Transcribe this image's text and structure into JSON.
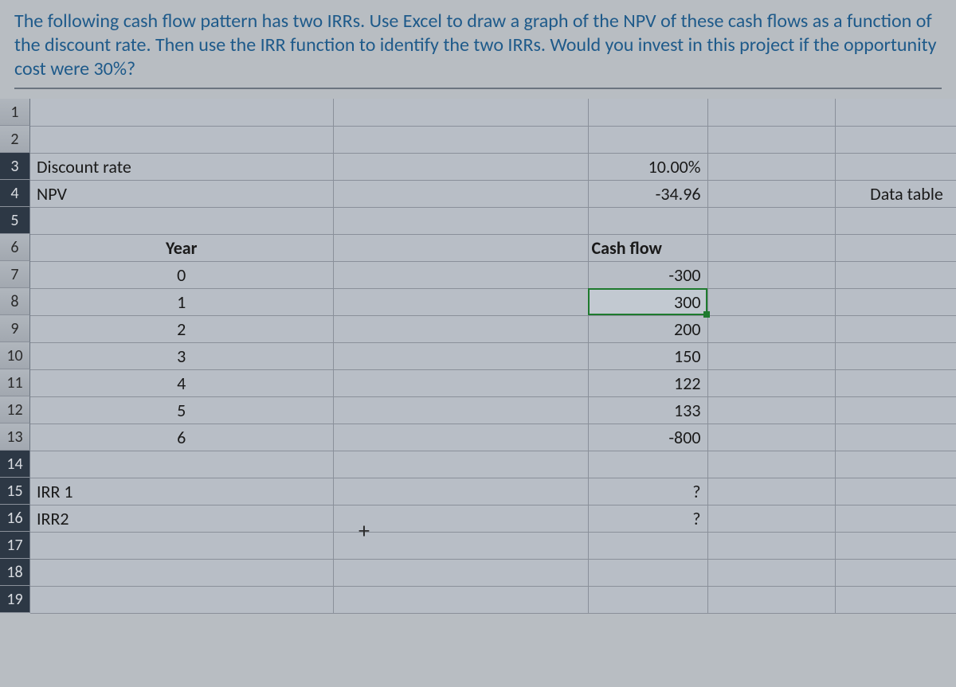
{
  "question": "The following cash flow pattern has two IRRs. Use Excel to draw a graph of the NPV of these cash flows as a function of the discount rate. Then use the IRR function to identify the two IRRs. Would you invest in this project if the opportunity cost were 30%?",
  "rows": {
    "r3": {
      "label": "Discount rate",
      "value": "10.00%"
    },
    "r4": {
      "label": "NPV",
      "value": "-34.96",
      "extra": "Data table"
    },
    "r6": {
      "yearHeader": "Year",
      "cfHeader": "Cash flow"
    },
    "r7": {
      "year": "0",
      "cf": "-300"
    },
    "r8": {
      "year": "1",
      "cf": "300"
    },
    "r9": {
      "year": "2",
      "cf": "200"
    },
    "r10": {
      "year": "3",
      "cf": "150"
    },
    "r11": {
      "year": "4",
      "cf": "122"
    },
    "r12": {
      "year": "5",
      "cf": "133"
    },
    "r13": {
      "year": "6",
      "cf": "-800"
    },
    "r15": {
      "label": "IRR 1",
      "cf": "?"
    },
    "r16": {
      "label": "IRR2",
      "cf": "?"
    }
  },
  "plusIcon": "+",
  "rowNumbers": [
    "1",
    "2",
    "3",
    "4",
    "5",
    "6",
    "7",
    "8",
    "9",
    "10",
    "11",
    "12",
    "13",
    "14",
    "15",
    "16",
    "17",
    "18",
    "19"
  ]
}
